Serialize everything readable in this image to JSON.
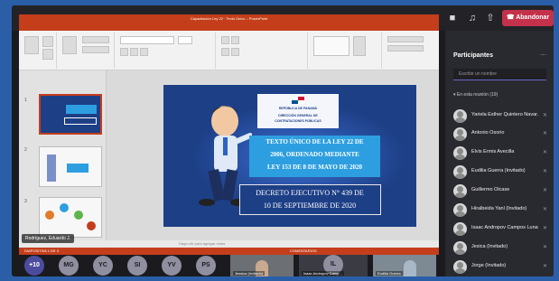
{
  "teams": {
    "leave_label": "Abandonar",
    "controls": [
      "camera-icon",
      "mic-icon",
      "share-icon"
    ]
  },
  "ppt": {
    "title": "Capacitación Ley 22 · Texto Único – PowerPoint",
    "tabs": [
      "ARCHIVO",
      "INICIO",
      "INSERTAR",
      "DISEÑO",
      "TRANSICIONES",
      "ANIMACIONES",
      "PRESENTACIÓN CON DIAPOSITIVAS",
      "REVISAR",
      "VISTA",
      "ACROBAT"
    ],
    "active_tab": "INICIO",
    "notes_placeholder": "Haga clic para agregar notas",
    "status_left": "DIAPOSITIVA 1 DE 3",
    "status_right": "COMENTARIOS",
    "thumb_numbers": [
      "1",
      "2",
      "3"
    ]
  },
  "slide": {
    "logo_lines": [
      "REPÚBLICA DE PANAMÁ",
      "DIRECCIÓN GENERAL DE",
      "CONTRATACIONES PÚBLICAS"
    ],
    "title_lines": [
      "TEXTO ÚNICO DE LA LEY 22 DE",
      "2006, ORDENADO MEDIANTE",
      "LEY 153 DE 8 DE MAYO DE 2020"
    ],
    "decree_lines": [
      "DECRETO EJECUTIVO N° 439 DE",
      "10 DE SEPTIEMBRE DE 2020"
    ]
  },
  "presenter_label": "Rodríguez, Eduardo J.",
  "panel": {
    "title": "Participantes",
    "invite_placeholder": "Escribir un nombre",
    "section_title": "En esta reunión (19)",
    "participants": [
      {
        "name": "Yariela Esther Quintero Navar..."
      },
      {
        "name": "Antonio Osorio"
      },
      {
        "name": "Elvis Ermis Avecilla"
      },
      {
        "name": "Eudilia Guerra (Invitado)"
      },
      {
        "name": "Guillermo Olcase"
      },
      {
        "name": "Hiralbeida Yanl (Invitado)"
      },
      {
        "name": "Isaac Andropov Campos Luna"
      },
      {
        "name": "Jesica (Invitado)"
      },
      {
        "name": "Jorge (Invitado)"
      }
    ]
  },
  "gallery": {
    "avatars": [
      "+10",
      "MG",
      "YC",
      "SI",
      "YV",
      "PS"
    ],
    "tiles": [
      {
        "name": "Jessica (Invitado)"
      },
      {
        "name": "IL"
      },
      {
        "name": "Isaac Andropov Camp..."
      },
      {
        "name": "Eudilia Guerra"
      }
    ]
  },
  "colors": {
    "teams_leave": "#c4314b",
    "ppt_accent": "#c43e1c",
    "slide_bg": "#1d3f86",
    "title_box": "#2d9fe0"
  }
}
